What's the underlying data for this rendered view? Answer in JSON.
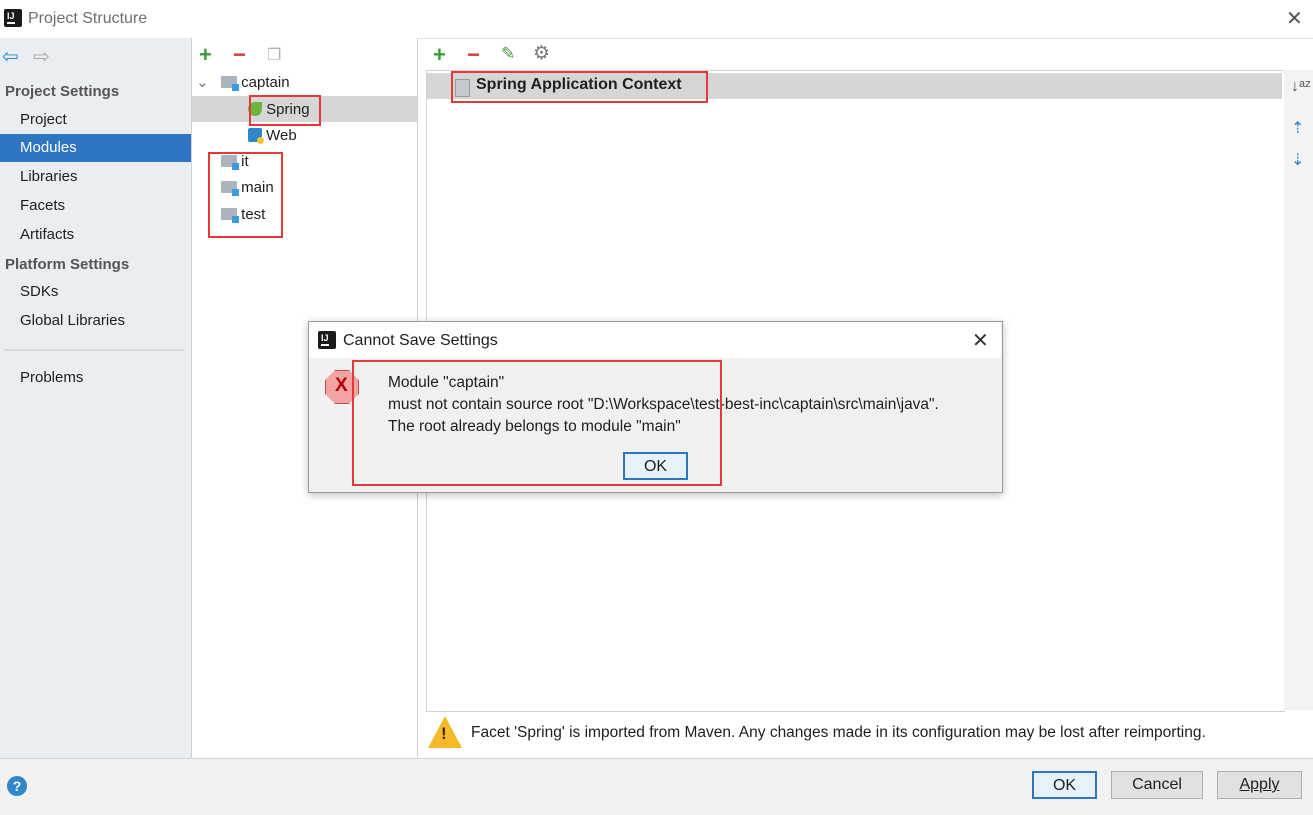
{
  "window": {
    "title": "Project Structure",
    "close_glyph": "✕"
  },
  "nav": {
    "back_glyph": "⇦",
    "forward_glyph": "⇨"
  },
  "sidebar": {
    "project_settings_header": "Project Settings",
    "project_items": [
      {
        "label": "Project",
        "selected": false
      },
      {
        "label": "Modules",
        "selected": true
      },
      {
        "label": "Libraries",
        "selected": false
      },
      {
        "label": "Facets",
        "selected": false
      },
      {
        "label": "Artifacts",
        "selected": false
      }
    ],
    "platform_settings_header": "Platform Settings",
    "platform_items": [
      {
        "label": "SDKs"
      },
      {
        "label": "Global Libraries"
      }
    ],
    "problems_label": "Problems"
  },
  "tree_toolbar": {
    "add_glyph": "+",
    "remove_glyph": "−",
    "copy_glyph": "❐"
  },
  "module_tree": {
    "expand_glyph": "⌄",
    "root": "captain",
    "children": [
      "Spring",
      "Web"
    ],
    "modules": [
      "it",
      "main",
      "test"
    ]
  },
  "facet_toolbar": {
    "add_glyph": "+",
    "remove_glyph": "−",
    "edit_glyph": "✎",
    "settings_glyph": "⚙"
  },
  "facet_list": {
    "selected_item": "Spring Application Context"
  },
  "right_tools": {
    "sort_glyph": "↓ᵃᶻ",
    "expand_glyph": "⇡",
    "collapse_glyph": "⇣"
  },
  "warning": {
    "glyph": "!",
    "text": "Facet 'Spring' is imported from Maven. Any changes made in its configuration may be lost after reimporting."
  },
  "dialog": {
    "title": "Cannot Save Settings",
    "close_glyph": "✕",
    "error_glyph": "X",
    "lines": [
      "Module \"captain\"",
      "must not contain source root \"D:\\Workspace\\test-best-inc\\captain\\src\\main\\java\".",
      "The root already belongs to module \"main\""
    ],
    "ok_label": "OK"
  },
  "footer": {
    "help_glyph": "?",
    "ok_label": "OK",
    "cancel_label": "Cancel",
    "apply_label": "Apply"
  },
  "colors": {
    "selection": "#2f76c2",
    "annotation_red": "#e53935",
    "warning_yellow": "#f5b92a"
  }
}
